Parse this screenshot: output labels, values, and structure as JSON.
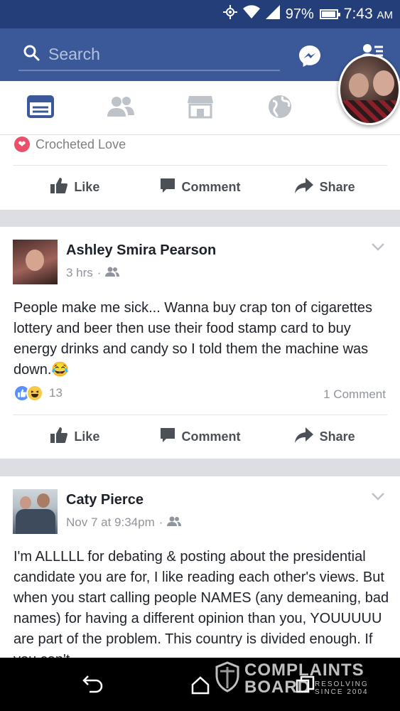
{
  "status_bar": {
    "battery": "97%",
    "time": "7:43",
    "ampm": "AM"
  },
  "header": {
    "search_placeholder": "Search"
  },
  "previous_post": {
    "page_name": "Crocheted Love",
    "actions": {
      "like": "Like",
      "comment": "Comment",
      "share": "Share"
    }
  },
  "posts": [
    {
      "author": "Ashley Smira Pearson",
      "time": "3 hrs",
      "text": "People make me sick... Wanna buy crap ton of cigarettes lottery and beer then use their food stamp card to buy energy drinks and candy so I told them the machine was down.😂",
      "reaction_count": "13",
      "comment_count": "1 Comment",
      "actions": {
        "like": "Like",
        "comment": "Comment",
        "share": "Share"
      }
    },
    {
      "author": "Caty Pierce",
      "time": "Nov 7 at 9:34pm",
      "text": "I'm ALLLLL for debating & posting about the presidential candidate you are for, I like reading each other's views. But when you start calling people NAMES (any demeaning, bad names) for having a different opinion than you, YOUUUUU are part of the problem. This country is divided enough. If you can't"
    }
  ],
  "watermark": {
    "line1": "COMPLAINTS",
    "line2": "BOARD",
    "sub1": "RESOLVING",
    "sub2": "SINCE 2004"
  },
  "colors": {
    "facebook_blue": "#3b5998",
    "status_blue": "#233e78",
    "like_blue": "#5890ff"
  }
}
